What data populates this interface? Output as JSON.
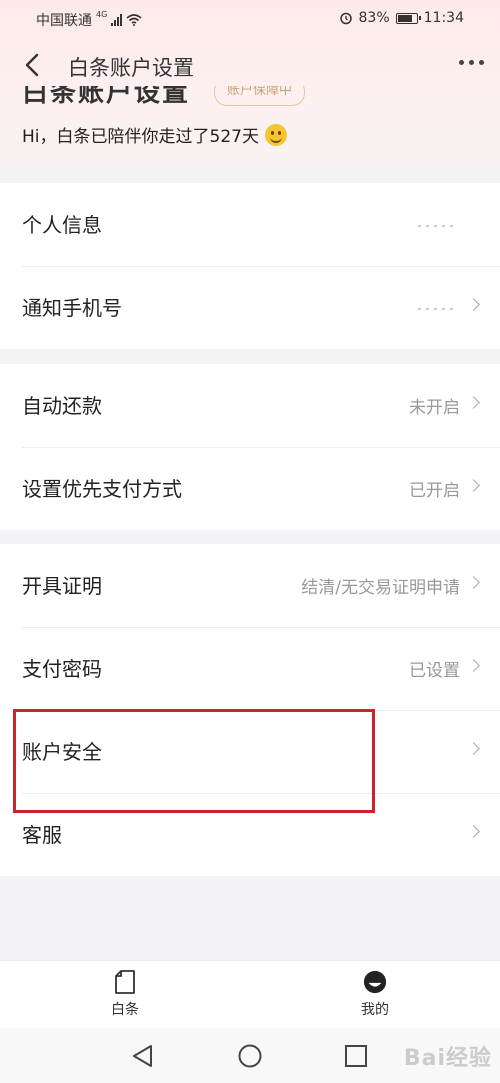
{
  "status_bar": {
    "carrier": "中国联通",
    "network": "4G",
    "battery": "83%",
    "battery_level": 0.83,
    "time": "11:34"
  },
  "nav": {
    "title": "白条账户设置",
    "back_icon": "chevron-left-icon",
    "more_icon": "more-dots-icon"
  },
  "header": {
    "peek_title": "白条账户设置",
    "peek_badge": "账户保障中",
    "greeting": "Hi，白条已陪伴你走过了527天"
  },
  "groups": [
    {
      "rows": [
        {
          "label": "个人信息",
          "value": "",
          "masked": true
        },
        {
          "label": "通知手机号",
          "value": "",
          "masked": true
        }
      ]
    },
    {
      "rows": [
        {
          "label": "自动还款",
          "value": "未开启"
        },
        {
          "label": "设置优先支付方式",
          "value": "已开启"
        }
      ]
    },
    {
      "rows": [
        {
          "label": "开具证明",
          "value": "结清/无交易证明申请"
        },
        {
          "label": "支付密码",
          "value": "已设置"
        },
        {
          "label": "账户安全",
          "value": ""
        },
        {
          "label": "客服",
          "value": ""
        }
      ]
    }
  ],
  "tabbar": {
    "tabs": [
      {
        "label": "白条",
        "icon": "card-icon",
        "active": false
      },
      {
        "label": "我的",
        "icon": "profile-face-icon",
        "active": true
      }
    ]
  },
  "system_nav": {
    "back_icon": "triangle-back-icon",
    "home_icon": "circle-home-icon",
    "recents_icon": "square-recents-icon"
  },
  "watermark": "Bai经验",
  "colors": {
    "highlight": "#c8252c",
    "header_tint": "#fde9e9",
    "value_grey": "#999999",
    "badge_gold": "#c9a27a"
  }
}
